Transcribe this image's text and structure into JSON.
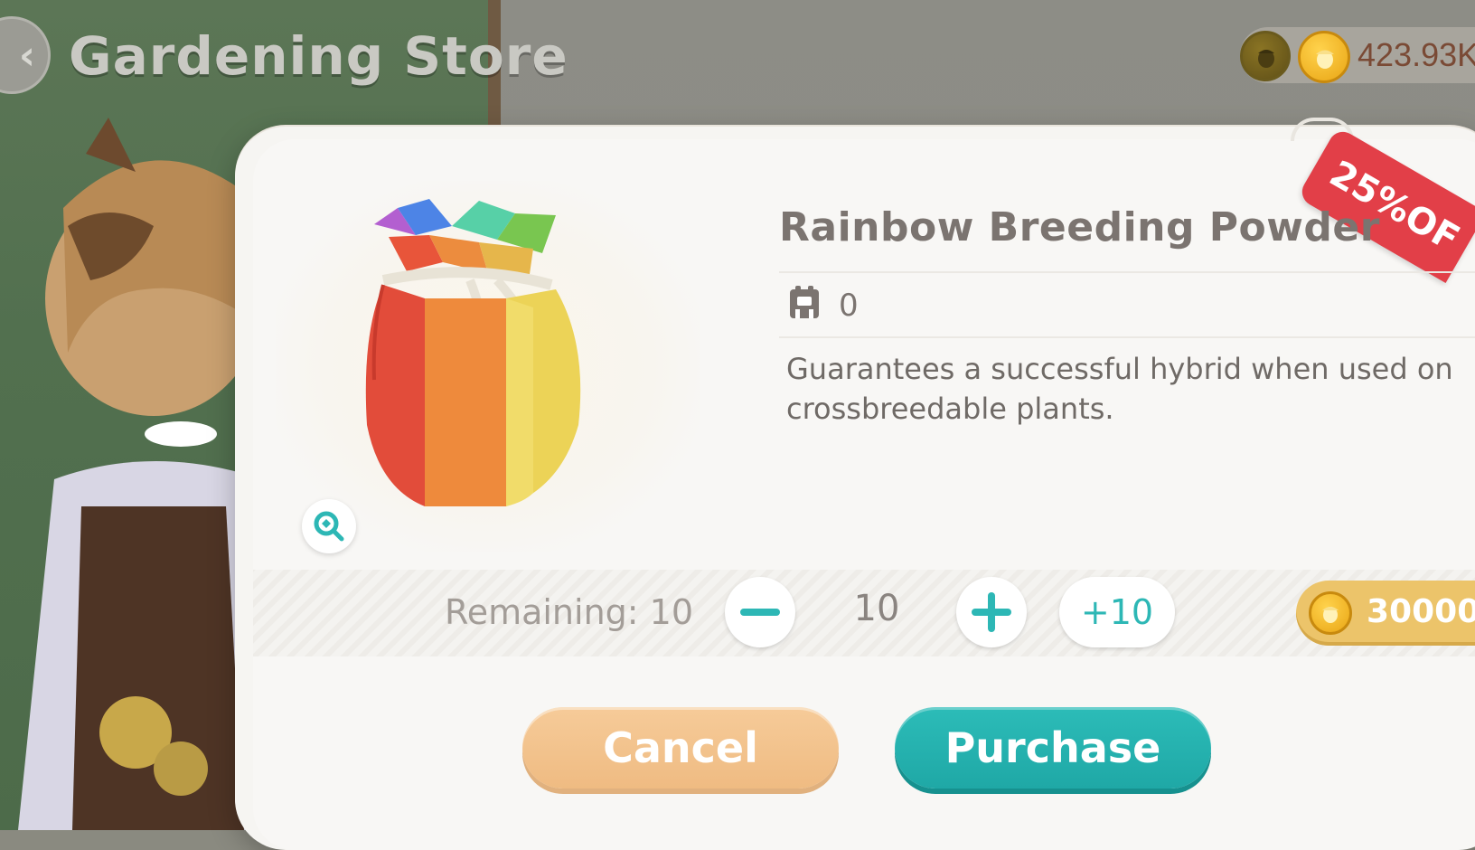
{
  "header": {
    "title": "Gardening Store",
    "back_icon": "back-arrow-icon",
    "currency_value": "423.93K"
  },
  "modal": {
    "sale_tag": "25%OF",
    "item_name": "Rainbow Breeding Powder",
    "owned_count": "0",
    "description": "Guarantees a successful hybrid when used on crossbreedable plants.",
    "remaining_label": "Remaining: 10",
    "quantity": "10",
    "plus_ten_label": "+10",
    "price": "30000",
    "cancel_label": "Cancel",
    "purchase_label": "Purchase"
  },
  "colors": {
    "accent_teal": "#1fa8a6",
    "cancel_orange": "#efbb82",
    "sale_red": "#e23f48",
    "price_gold": "#ecc46a"
  }
}
